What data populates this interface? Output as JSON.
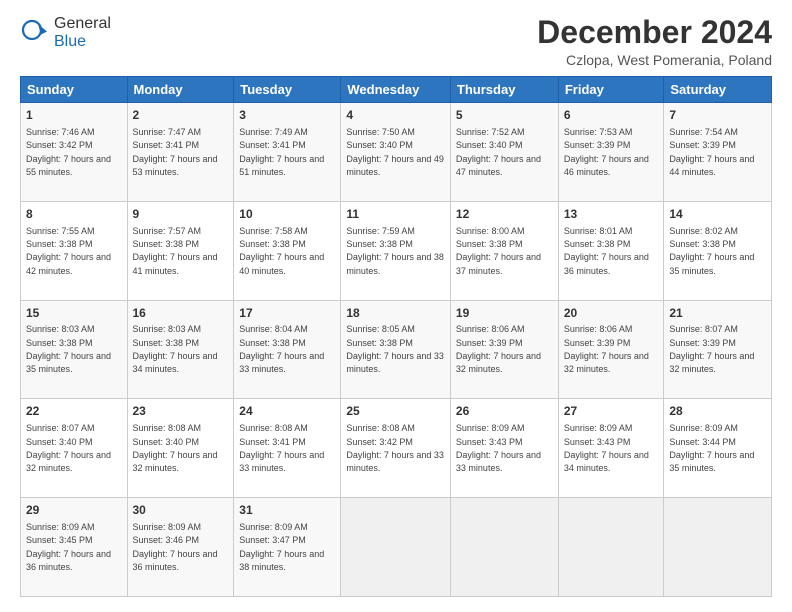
{
  "header": {
    "logo_general": "General",
    "logo_blue": "Blue",
    "month_title": "December 2024",
    "location": "Czlopa, West Pomerania, Poland"
  },
  "days_of_week": [
    "Sunday",
    "Monday",
    "Tuesday",
    "Wednesday",
    "Thursday",
    "Friday",
    "Saturday"
  ],
  "weeks": [
    [
      {
        "day": "1",
        "sunrise": "7:46 AM",
        "sunset": "3:42 PM",
        "daylight": "7 hours and 55 minutes."
      },
      {
        "day": "2",
        "sunrise": "7:47 AM",
        "sunset": "3:41 PM",
        "daylight": "7 hours and 53 minutes."
      },
      {
        "day": "3",
        "sunrise": "7:49 AM",
        "sunset": "3:41 PM",
        "daylight": "7 hours and 51 minutes."
      },
      {
        "day": "4",
        "sunrise": "7:50 AM",
        "sunset": "3:40 PM",
        "daylight": "7 hours and 49 minutes."
      },
      {
        "day": "5",
        "sunrise": "7:52 AM",
        "sunset": "3:40 PM",
        "daylight": "7 hours and 47 minutes."
      },
      {
        "day": "6",
        "sunrise": "7:53 AM",
        "sunset": "3:39 PM",
        "daylight": "7 hours and 46 minutes."
      },
      {
        "day": "7",
        "sunrise": "7:54 AM",
        "sunset": "3:39 PM",
        "daylight": "7 hours and 44 minutes."
      }
    ],
    [
      {
        "day": "8",
        "sunrise": "7:55 AM",
        "sunset": "3:38 PM",
        "daylight": "7 hours and 42 minutes."
      },
      {
        "day": "9",
        "sunrise": "7:57 AM",
        "sunset": "3:38 PM",
        "daylight": "7 hours and 41 minutes."
      },
      {
        "day": "10",
        "sunrise": "7:58 AM",
        "sunset": "3:38 PM",
        "daylight": "7 hours and 40 minutes."
      },
      {
        "day": "11",
        "sunrise": "7:59 AM",
        "sunset": "3:38 PM",
        "daylight": "7 hours and 38 minutes."
      },
      {
        "day": "12",
        "sunrise": "8:00 AM",
        "sunset": "3:38 PM",
        "daylight": "7 hours and 37 minutes."
      },
      {
        "day": "13",
        "sunrise": "8:01 AM",
        "sunset": "3:38 PM",
        "daylight": "7 hours and 36 minutes."
      },
      {
        "day": "14",
        "sunrise": "8:02 AM",
        "sunset": "3:38 PM",
        "daylight": "7 hours and 35 minutes."
      }
    ],
    [
      {
        "day": "15",
        "sunrise": "8:03 AM",
        "sunset": "3:38 PM",
        "daylight": "7 hours and 35 minutes."
      },
      {
        "day": "16",
        "sunrise": "8:03 AM",
        "sunset": "3:38 PM",
        "daylight": "7 hours and 34 minutes."
      },
      {
        "day": "17",
        "sunrise": "8:04 AM",
        "sunset": "3:38 PM",
        "daylight": "7 hours and 33 minutes."
      },
      {
        "day": "18",
        "sunrise": "8:05 AM",
        "sunset": "3:38 PM",
        "daylight": "7 hours and 33 minutes."
      },
      {
        "day": "19",
        "sunrise": "8:06 AM",
        "sunset": "3:39 PM",
        "daylight": "7 hours and 32 minutes."
      },
      {
        "day": "20",
        "sunrise": "8:06 AM",
        "sunset": "3:39 PM",
        "daylight": "7 hours and 32 minutes."
      },
      {
        "day": "21",
        "sunrise": "8:07 AM",
        "sunset": "3:39 PM",
        "daylight": "7 hours and 32 minutes."
      }
    ],
    [
      {
        "day": "22",
        "sunrise": "8:07 AM",
        "sunset": "3:40 PM",
        "daylight": "7 hours and 32 minutes."
      },
      {
        "day": "23",
        "sunrise": "8:08 AM",
        "sunset": "3:40 PM",
        "daylight": "7 hours and 32 minutes."
      },
      {
        "day": "24",
        "sunrise": "8:08 AM",
        "sunset": "3:41 PM",
        "daylight": "7 hours and 33 minutes."
      },
      {
        "day": "25",
        "sunrise": "8:08 AM",
        "sunset": "3:42 PM",
        "daylight": "7 hours and 33 minutes."
      },
      {
        "day": "26",
        "sunrise": "8:09 AM",
        "sunset": "3:43 PM",
        "daylight": "7 hours and 33 minutes."
      },
      {
        "day": "27",
        "sunrise": "8:09 AM",
        "sunset": "3:43 PM",
        "daylight": "7 hours and 34 minutes."
      },
      {
        "day": "28",
        "sunrise": "8:09 AM",
        "sunset": "3:44 PM",
        "daylight": "7 hours and 35 minutes."
      }
    ],
    [
      {
        "day": "29",
        "sunrise": "8:09 AM",
        "sunset": "3:45 PM",
        "daylight": "7 hours and 36 minutes."
      },
      {
        "day": "30",
        "sunrise": "8:09 AM",
        "sunset": "3:46 PM",
        "daylight": "7 hours and 36 minutes."
      },
      {
        "day": "31",
        "sunrise": "8:09 AM",
        "sunset": "3:47 PM",
        "daylight": "7 hours and 38 minutes."
      },
      null,
      null,
      null,
      null
    ]
  ],
  "labels": {
    "sunrise": "Sunrise:",
    "sunset": "Sunset:",
    "daylight": "Daylight:"
  }
}
